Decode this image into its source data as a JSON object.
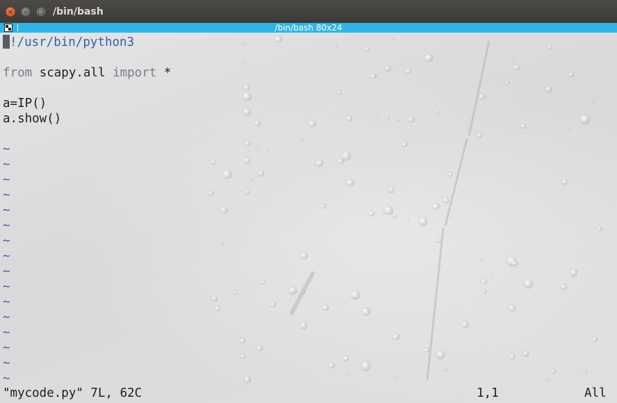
{
  "window": {
    "title": "/bin/bash",
    "close_symbol": "×",
    "minimize_symbol": "–",
    "maximize_symbol": "□"
  },
  "tab": {
    "title": "/bin/bash 80x24",
    "icon": "split-terminal-icon"
  },
  "editor": {
    "lines": {
      "shebang": "!/usr/bin/python3",
      "from_kw": "from",
      "from_mod": " scapy.all ",
      "import_kw": "import",
      "import_rest": " *",
      "line3": "a=IP()",
      "line4": "a.show()"
    },
    "tilde": "~"
  },
  "status": {
    "message": "\"mycode.py\" 7L, 62C",
    "position": "1,1",
    "scroll": "All"
  },
  "colors": {
    "tab_bar": "#2fb6e8",
    "comment": "#3a5ea8",
    "keyword": "#7a7a8e"
  }
}
